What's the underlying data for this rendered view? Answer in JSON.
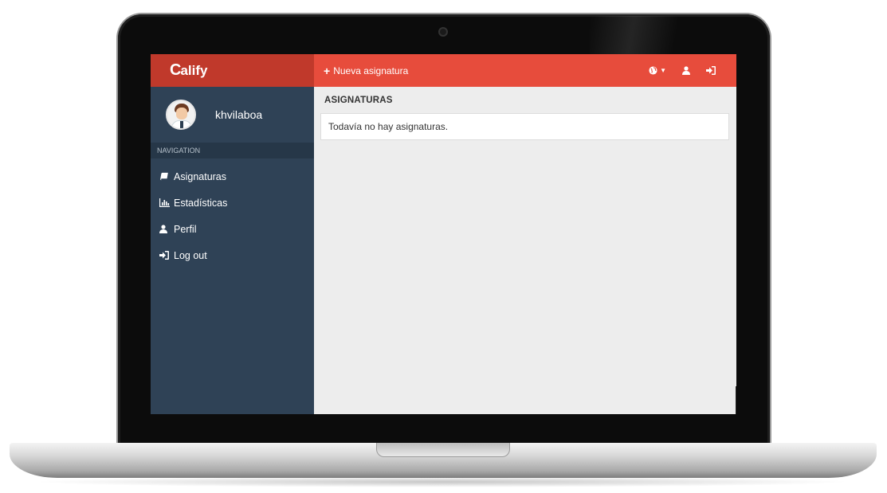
{
  "sidebar": {
    "brand": {
      "mark": "C",
      "rest": "alify"
    },
    "username": "khvilaboa",
    "nav_header": "NAVIGATION",
    "items": [
      {
        "label": "Asignaturas",
        "icon": "book-icon"
      },
      {
        "label": "Estadísticas",
        "icon": "bar-chart-icon"
      },
      {
        "label": "Perfil",
        "icon": "user-icon"
      },
      {
        "label": "Log out",
        "icon": "sign-in-icon"
      }
    ]
  },
  "topbar": {
    "new_label": "Nueva asignatura",
    "icons": [
      "globe-icon",
      "user-icon",
      "sign-in-icon"
    ]
  },
  "main": {
    "title": "ASIGNATURAS",
    "empty_message": "Todavía no hay asignaturas."
  },
  "colors": {
    "brand_bg": "#c0392b",
    "topbar_bg": "#e74c3c",
    "sidebar_bg": "#2f4256",
    "content_bg": "#ededed"
  }
}
